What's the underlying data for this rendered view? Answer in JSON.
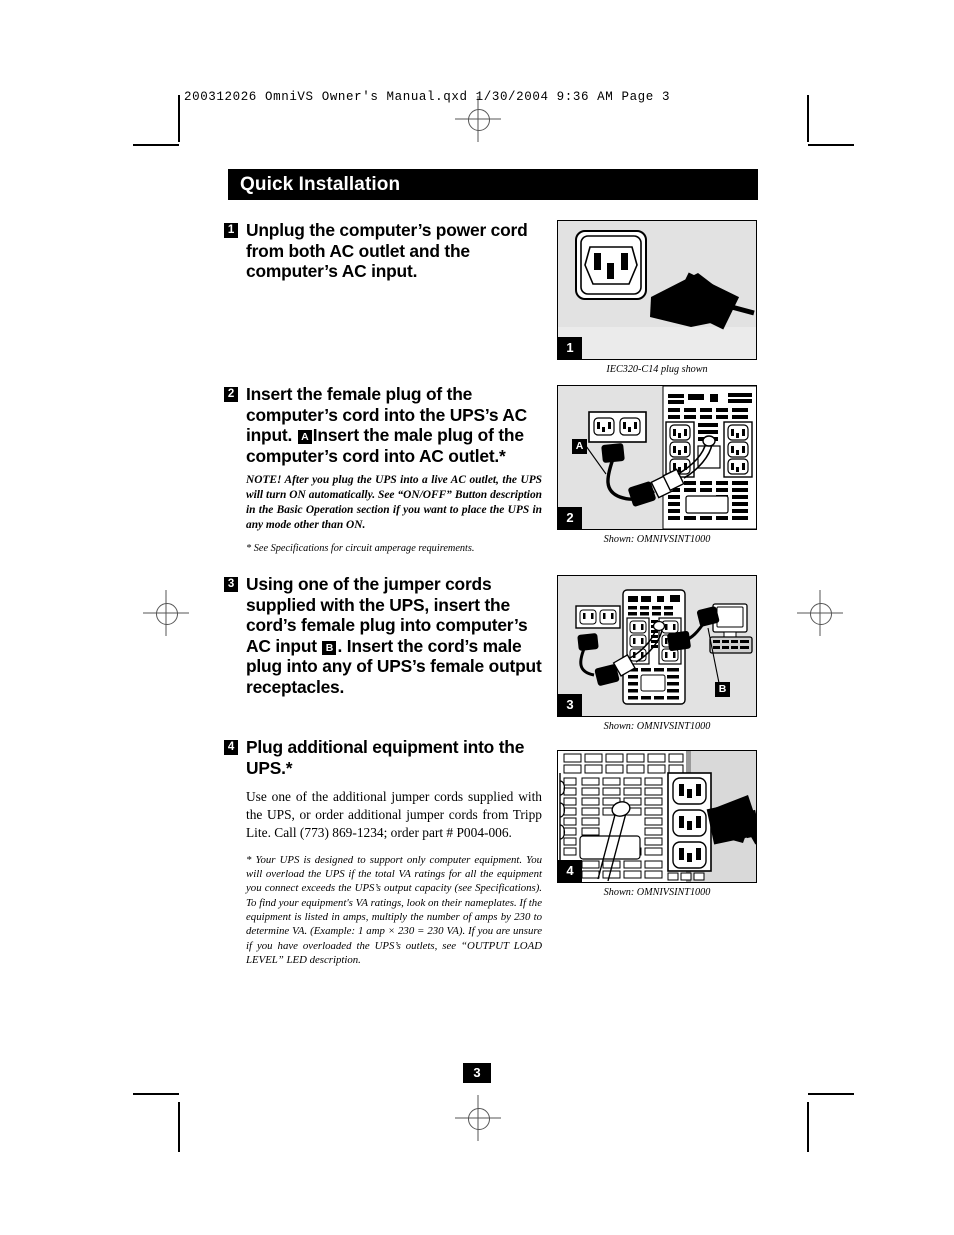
{
  "printer_slug": "200312026 OmniVS Owner's Manual.qxd  1/30/2004  9:36 AM  Page 3",
  "section": {
    "title": "Quick Installation"
  },
  "page_number": "3",
  "steps": [
    {
      "number": "1",
      "heading": "Unplug the computer’s power cord from both AC outlet and the computer’s AC input.",
      "heading_parts": [
        "Unplug the computer’s power cord from both AC outlet and the computer’s AC input."
      ]
    },
    {
      "number": "2",
      "heading_part1": "Insert the female plug of the computer’s cord into the UPS’s AC input.",
      "inline_badge": "A",
      "heading_part2": "Insert the male plug of the computer’s cord into AC outlet.*",
      "note": "NOTE! After you plug the UPS into a live AC outlet, the UPS will turn ON automatically. See “ON/OFF” Button description in the Basic Operation section if you want to place the UPS in any mode other than ON.",
      "footnote": "* See Specifications for circuit amperage requirements."
    },
    {
      "number": "3",
      "heading_part1": "Using one of the jumper cords supplied with the UPS, insert the cord’s female plug into computer’s AC input",
      "inline_badge": "B",
      "heading_part2": ". Insert the cord’s male plug into any of UPS’s female output receptacles."
    },
    {
      "number": "4",
      "heading": "Plug additional equipment into the UPS.*",
      "body": "Use one of the additional jumper cords supplied with the UPS, or order additional jumper cords from Tripp Lite. Call (773) 869-1234; order part # P004-006.",
      "fineprint": "* Your UPS is designed to support only computer equipment. You will overload the UPS if the total VA ratings for all the equipment you connect exceeds the UPS’s output capacity (see Specifications). To find your equipment's VA ratings, look on their nameplates. If the equipment is listed in amps, multiply the number of amps by 230 to determine VA. (Example: 1 amp × 230 = 230 VA). If you are unsure if you have overloaded the UPS’s outlets, see “OUTPUT LOAD LEVEL” LED description."
    }
  ],
  "figures": [
    {
      "panel_number": "1",
      "caption": "IEC320-C14 plug shown",
      "alt": "IEC320-C14 female inlet with black power cord plug"
    },
    {
      "panel_number": "2",
      "caption": "Shown: OMNIVSINT1000",
      "callout": "A",
      "alt": "AC wall outlet connected by cord to the rear panel of the UPS AC input"
    },
    {
      "panel_number": "3",
      "caption": "Shown: OMNIVSINT1000",
      "callout": "B",
      "alt": "Jumper cord from UPS output receptacle to computer AC input"
    },
    {
      "panel_number": "4",
      "caption": "Shown: OMNIVSINT1000",
      "alt": "Close-up of UPS rear output receptacles with cord plugged in"
    }
  ],
  "colors": {
    "ink": "#000000",
    "panel_background": "#e2e2e2",
    "panel_device": "#ffffff",
    "reg_mark": "#555555"
  }
}
